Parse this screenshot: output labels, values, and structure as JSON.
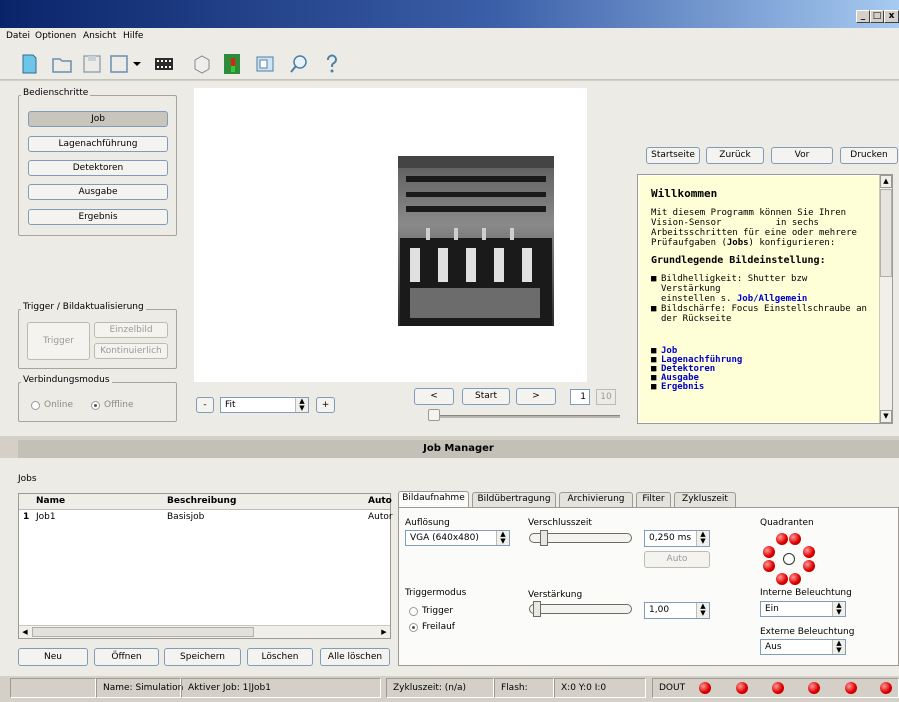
{
  "window": {
    "controls": [
      "_",
      "□",
      "x"
    ]
  },
  "menu": [
    "Datei",
    "Optionen",
    "Ansicht",
    "Hilfe"
  ],
  "toolbar_icons": [
    "new-document-icon",
    "open-folder-icon",
    "save-icon",
    "save-as-icon",
    "film-icon",
    "camera-icon",
    "signal-icon",
    "window-icon",
    "search-icon",
    "help-icon"
  ],
  "steps": {
    "title": "Bedienschritte",
    "items": [
      "Job",
      "Lagenachführung",
      "Detektoren",
      "Ausgabe",
      "Ergebnis"
    ]
  },
  "trigger": {
    "title": "Trigger / Bildaktualisierung",
    "trigger_btn": "Trigger",
    "single_btn": "Einzelbild",
    "cont_btn": "Kontinuierlich"
  },
  "connection": {
    "title": "Verbindungsmodus",
    "online": "Online",
    "offline": "Offline"
  },
  "zoom": {
    "minus": "-",
    "value": "Fit",
    "plus": "+"
  },
  "nav": {
    "prev": "<",
    "start": "Start",
    "next": ">",
    "frame": "1",
    "total": "10"
  },
  "browser": {
    "home": "Startseite",
    "back": "Zurück",
    "forward": "Vor",
    "print": "Drucken"
  },
  "help": {
    "heading": "Willkommen",
    "intro_1": "Mit diesem Programm können Sie Ihren",
    "intro_2": "Vision-Sensor          in sechs",
    "intro_3": "Arbeitsschritten für eine oder mehrere",
    "intro_4a": "Prüfaufgaben (",
    "intro_4b": "Jobs",
    "intro_4c": ") konfigurieren:",
    "subheading": "Grundlegende Bildeinstellung:",
    "b1_1": "Bildhelligkeit: Shutter bzw Verstärkung",
    "b1_2a": "einstellen s. ",
    "b1_2b": "Job/Allgemein",
    "b2_1": "Bildschärfe: Focus Einstellschraube an",
    "b2_2": "der Rückseite",
    "links": [
      "Job",
      "Lagenachführung",
      "Detektoren",
      "Ausgabe",
      "Ergebnis"
    ]
  },
  "job_manager": {
    "title": "Job Manager",
    "jobs_label": "Jobs",
    "columns": [
      "Name",
      "Beschreibung",
      "Auto"
    ],
    "rows": [
      {
        "index": "1",
        "name": "Job1",
        "desc": "Basisjob",
        "auto": "Autor"
      }
    ],
    "buttons": [
      "Neu",
      "Öffnen",
      "Speichern",
      "Löschen",
      "Alle löschen"
    ]
  },
  "tabs": [
    "Bildaufnahme",
    "Bildübertragung",
    "Archivierung",
    "Filter",
    "Zykluszeit"
  ],
  "capture": {
    "resolution_label": "Auflösung",
    "resolution_value": "VGA (640x480)",
    "shutter_label": "Verschlusszeit",
    "shutter_value": "0,250 ms",
    "auto_btn": "Auto",
    "trigger_label": "Triggermodus",
    "trigger_opt": "Trigger",
    "freerun_opt": "Freilauf",
    "gain_label": "Verstärkung",
    "gain_value": "1,00",
    "quadrants_label": "Quadranten",
    "int_light_label": "Interne Beleuchtung",
    "int_light_value": "Ein",
    "ext_light_label": "Externe Beleuchtung",
    "ext_light_value": "Aus"
  },
  "status": {
    "name": "Name:  Simulation",
    "job": "Aktiver Job:  1|Job1",
    "cycle": "Zykluszeit:  (n/a)",
    "flash": "Flash:",
    "coords": "X:0 Y:0 I:0",
    "dout": "DOUT"
  }
}
